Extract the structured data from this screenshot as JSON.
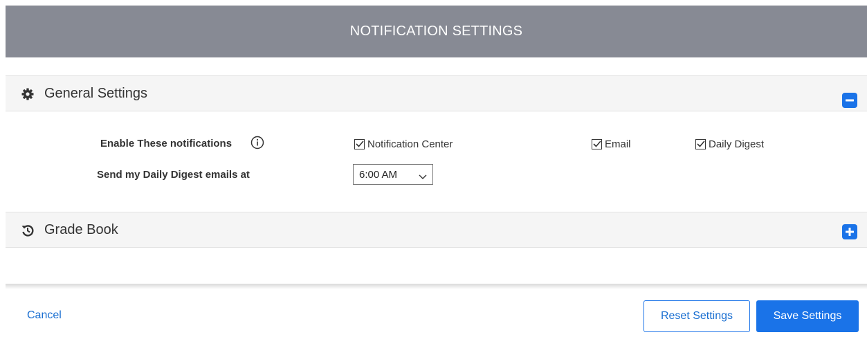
{
  "header": {
    "title": "NOTIFICATION SETTINGS"
  },
  "sections": {
    "general": {
      "title": "General Settings",
      "icon": "gear-icon",
      "toggle_icon": "minus-square-icon",
      "enable_label": "Enable These notifications",
      "info_icon": "info-icon",
      "options": [
        {
          "label": "Notification Center",
          "checked": true
        },
        {
          "label": "Email",
          "checked": true
        },
        {
          "label": "Daily Digest",
          "checked": true
        }
      ],
      "digest_label": "Send my Daily Digest emails at",
      "digest_time": "6:00 AM"
    },
    "grade_book": {
      "title": "Grade Book",
      "icon": "history-icon",
      "toggle_icon": "plus-square-icon"
    }
  },
  "footer": {
    "cancel_label": "Cancel",
    "reset_label": "Reset Settings",
    "save_label": "Save Settings"
  },
  "colors": {
    "header_bg": "#878a94",
    "accent": "#1a73e8"
  }
}
